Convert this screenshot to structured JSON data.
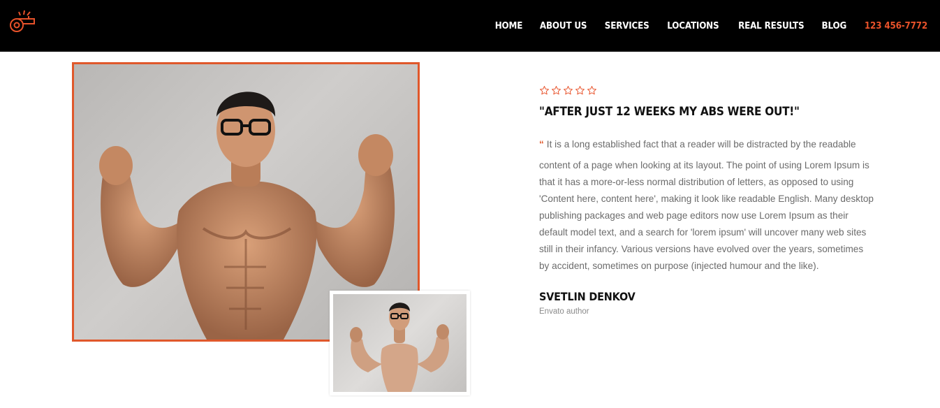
{
  "brand": {
    "accent": "#e8522a",
    "logo_icon": "whistle-icon"
  },
  "nav": {
    "items": [
      {
        "label": "HOME"
      },
      {
        "label": "ABOUT US"
      },
      {
        "label": "SERVICES"
      },
      {
        "label": "LOCATIONS"
      },
      {
        "label": "REAL RESULTS"
      },
      {
        "label": "BLOG"
      }
    ],
    "phone": "123 456-7772"
  },
  "testimonial": {
    "rating": 0,
    "rating_max": 5,
    "title": "\"AFTER JUST 12 WEEKS MY ABS WERE OUT!\"",
    "quote_mark": "“",
    "body_first": "It is a long established fact that a reader will be distracted by the readable",
    "body_rest": "content of a page when looking at its layout. The point of using Lorem Ipsum is that it has a more-or-less normal distribution of letters, as opposed to using 'Content here, content here', making it look like readable English. Many desktop publishing packages and web page editors now use Lorem Ipsum as their default model text, and a search for 'lorem ipsum' will uncover many web sites still in their infancy. Various versions have evolved over the years, sometimes by accident, sometimes on purpose (injected humour and the like).",
    "author": "SVETLIN DENKOV",
    "role": "Envato author"
  }
}
